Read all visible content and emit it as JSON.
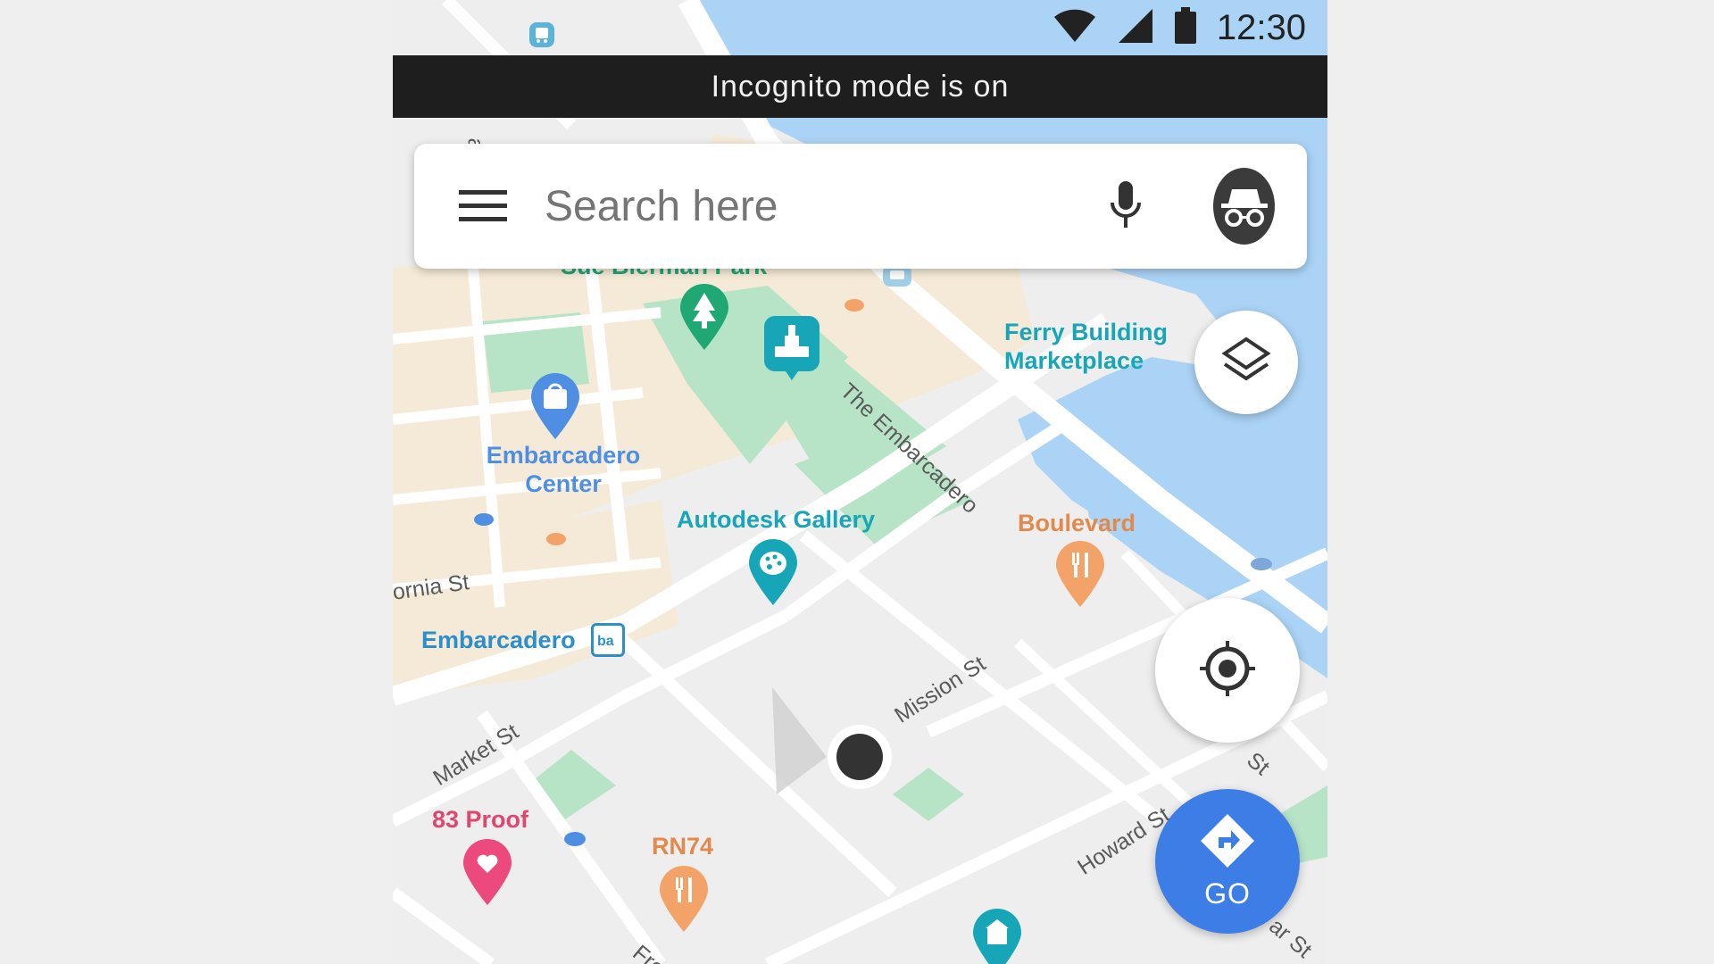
{
  "status_bar": {
    "time": "12:30"
  },
  "banner": {
    "text": "Incognito mode is on"
  },
  "search": {
    "placeholder": "Search here"
  },
  "go_button": {
    "label": "GO"
  },
  "places": {
    "park_partial": "Sue Bierman Park",
    "ferry_line1": "Ferry Building",
    "ferry_line2": "Marketplace",
    "embarcadero_center_line1": "Embarcadero",
    "embarcadero_center_line2": "Center",
    "autodesk": "Autodesk Gallery",
    "boulevard": "Boulevard",
    "embarcadero_station": "Embarcadero",
    "proof": "83 Proof",
    "rn74": "RN74"
  },
  "streets": {
    "the_embarcadero": "The Embarcadero",
    "california": "ornia St",
    "market": "Market St",
    "mission": "Mission St",
    "howard": "Howard St",
    "fremont_partial": "Fre",
    "st_partial_1": "St",
    "st_partial_2": "ar St",
    "davis_partial": "avi"
  },
  "colors": {
    "water": "#aad3f5",
    "park": "#b7e4c7",
    "land": "#eeeeee",
    "block": "#f5ead7",
    "road": "#ffffff",
    "banner": "#1e1e1e",
    "go": "#3d7ee6",
    "green_pin": "#1fa774",
    "teal_pin": "#17a6b8",
    "blue_pin": "#4e8fe4",
    "orange_pin": "#f3a367",
    "pink_pin": "#ec4a7e"
  }
}
